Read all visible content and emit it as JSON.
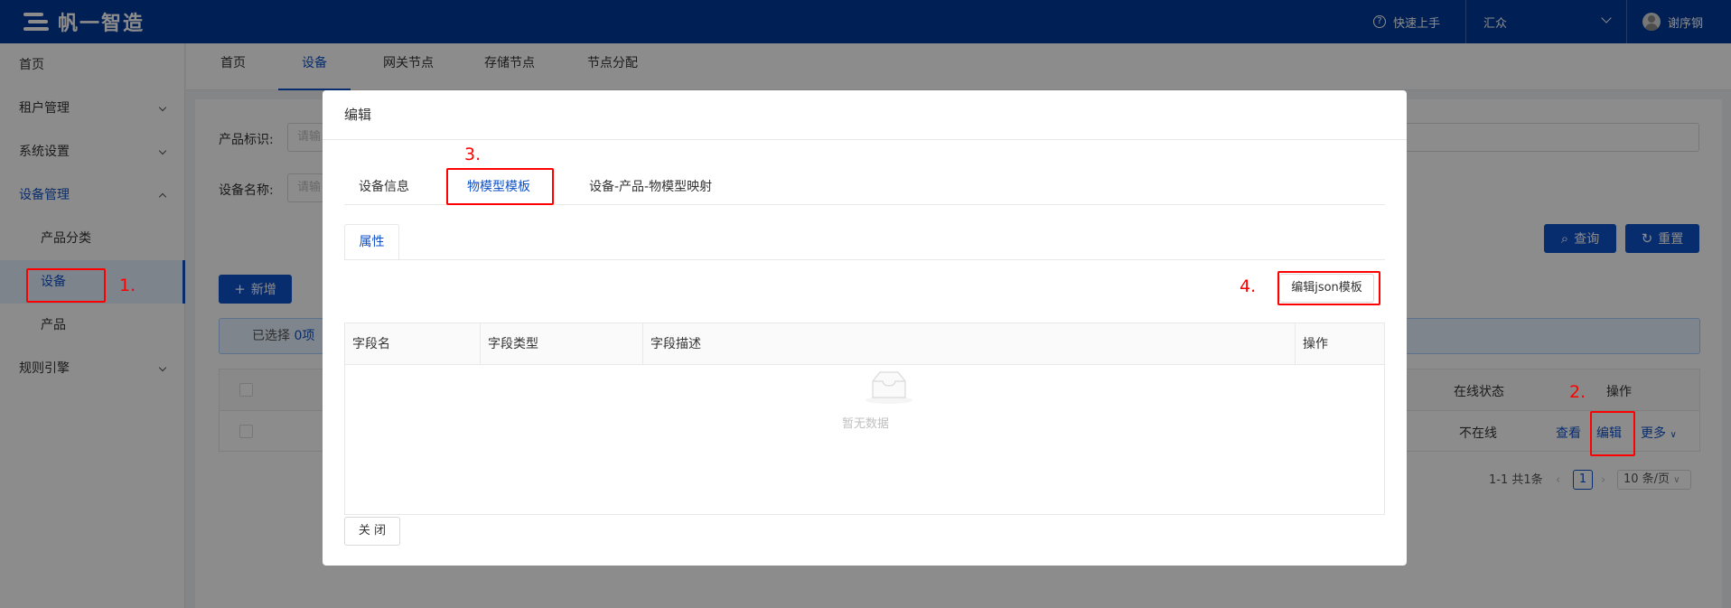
{
  "header": {
    "logo_text": "帆一智造",
    "help_label": "快速上手",
    "tenant_label": "汇众",
    "user_name": "谢序钢"
  },
  "sidebar": {
    "items": [
      {
        "label": "首页"
      },
      {
        "label": "租户管理"
      },
      {
        "label": "系统设置"
      },
      {
        "label": "设备管理"
      },
      {
        "label": "产品分类"
      },
      {
        "label": "设备"
      },
      {
        "label": "产品"
      },
      {
        "label": "规则引擎"
      }
    ]
  },
  "tabs": [
    {
      "label": "首页"
    },
    {
      "label": "设备"
    },
    {
      "label": "网关节点"
    },
    {
      "label": "存储节点"
    },
    {
      "label": "节点分配"
    }
  ],
  "filters": {
    "product_label": "产品标识:",
    "device_label": "设备名称:",
    "placeholder": "请输",
    "query_label": "查询",
    "reset_label": "重置"
  },
  "toolbar": {
    "add_label": "新增"
  },
  "selection": {
    "prefix": "已选择",
    "count": "0项"
  },
  "table": {
    "columns": [
      "在线状态",
      "操作"
    ],
    "rows": [
      {
        "status": "不在线",
        "actions": [
          "查看",
          "编辑",
          "更多"
        ]
      }
    ]
  },
  "pagination": {
    "summary": "1-1 共1条",
    "current_page": "1",
    "page_size": "10 条/页"
  },
  "modal": {
    "title": "编辑",
    "tabs": [
      "设备信息",
      "物模型模板",
      "设备-产品-物模型映射"
    ],
    "sub_tab": "属性",
    "edit_json_label": "编辑json模板",
    "columns": [
      "字段名",
      "字段类型",
      "字段描述",
      "操作"
    ],
    "empty_text": "暂无数据",
    "close_label": "关 闭"
  },
  "annotations": [
    "1.",
    "2.",
    "3.",
    "4."
  ],
  "colors": {
    "header_bg": "#003a99",
    "primary": "#1052c9",
    "annotation": "#ff0000"
  }
}
